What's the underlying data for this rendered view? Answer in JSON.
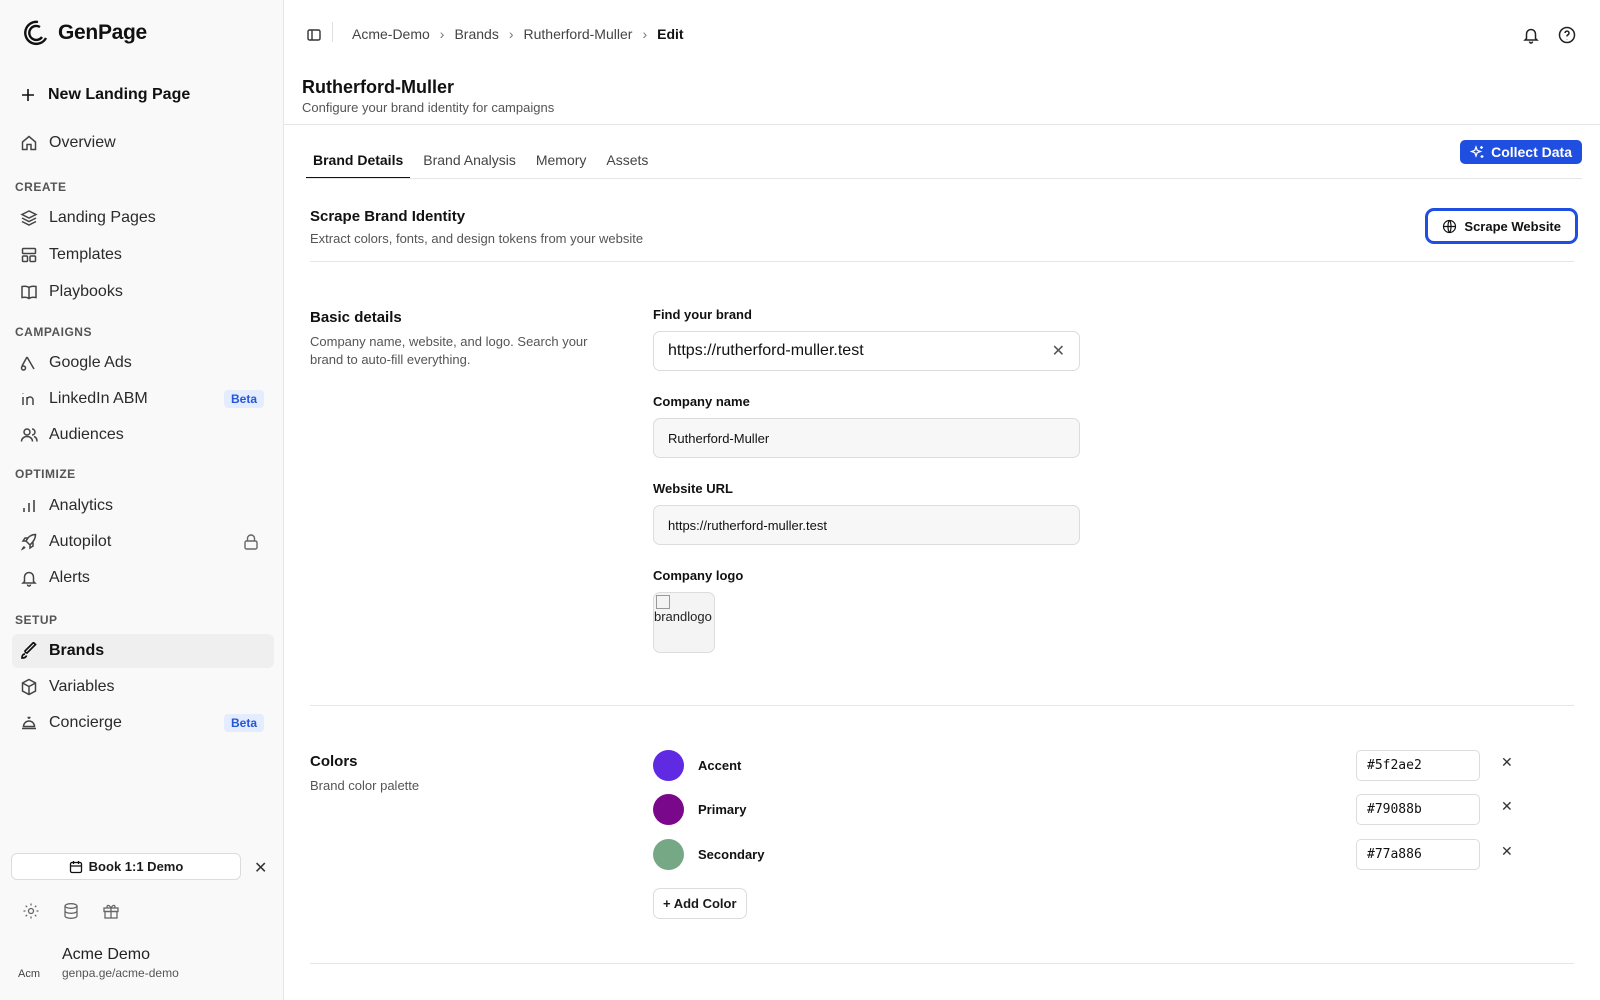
{
  "app": {
    "name": "GenPage"
  },
  "sidebar": {
    "new_page_label": "New Landing Page",
    "overview_label": "Overview",
    "sections": {
      "create": "CREATE",
      "campaigns": "CAMPAIGNS",
      "optimize": "OPTIMIZE",
      "setup": "SETUP"
    },
    "items": {
      "landing_pages": "Landing Pages",
      "templates": "Templates",
      "playbooks": "Playbooks",
      "google_ads": "Google Ads",
      "linkedin_abm": "LinkedIn ABM",
      "audiences": "Audiences",
      "analytics": "Analytics",
      "autopilot": "Autopilot",
      "alerts": "Alerts",
      "brands": "Brands",
      "variables": "Variables",
      "concierge": "Concierge"
    },
    "beta_label": "Beta",
    "book_demo_label": "Book 1:1 Demo",
    "profile": {
      "name": "Acme Demo",
      "url": "genpa.ge/acme-demo",
      "avatar_alt": "Acm"
    }
  },
  "breadcrumb": {
    "org": "Acme-Demo",
    "section": "Brands",
    "brand": "Rutherford-Muller",
    "current": "Edit"
  },
  "header": {
    "title": "Rutherford-Muller",
    "subtitle": "Configure your brand identity for campaigns"
  },
  "tabs": [
    "Brand Details",
    "Brand Analysis",
    "Memory",
    "Assets"
  ],
  "collect_data_label": "Collect Data",
  "scrape": {
    "title": "Scrape Brand Identity",
    "subtitle": "Extract colors, fonts, and design tokens from your website",
    "button_label": "Scrape Website"
  },
  "basic": {
    "title": "Basic details",
    "description": "Company name, website, and logo. Search your brand to auto-fill everything.",
    "find_label": "Find your brand",
    "find_value": "https://rutherford-muller.test",
    "company_label": "Company name",
    "company_value": "Rutherford-Muller",
    "website_label": "Website URL",
    "website_value": "https://rutherford-muller.test",
    "logo_label": "Company logo",
    "logo_alt": "brandlogo"
  },
  "colors": {
    "title": "Colors",
    "description": "Brand color palette",
    "items": [
      {
        "name": "Accent",
        "hex": "#5f2ae2"
      },
      {
        "name": "Primary",
        "hex": "#79088b"
      },
      {
        "name": "Secondary",
        "hex": "#77a886"
      }
    ],
    "add_label": "+ Add Color"
  },
  "theme": {
    "brand_blue": "#1f4fe0",
    "beta_bg": "#e4ecff",
    "beta_text": "#2456d8"
  }
}
